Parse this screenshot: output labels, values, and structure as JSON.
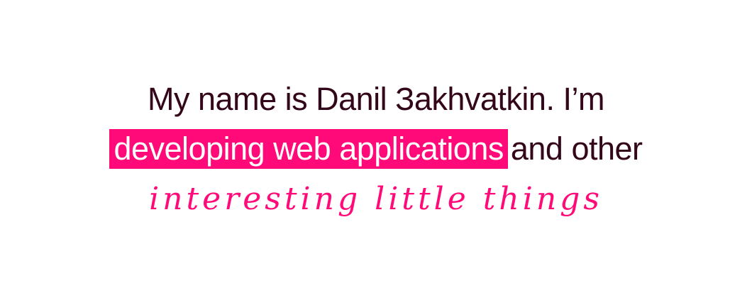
{
  "hero": {
    "intro": "My name is Danil Заkhvatkin. I’m",
    "highlight": "developing web applications",
    "continuation": "and other",
    "tagline": "interesting little things"
  },
  "colors": {
    "text": "#330719",
    "accent": "#ff0a78",
    "background": "#ffffff"
  }
}
